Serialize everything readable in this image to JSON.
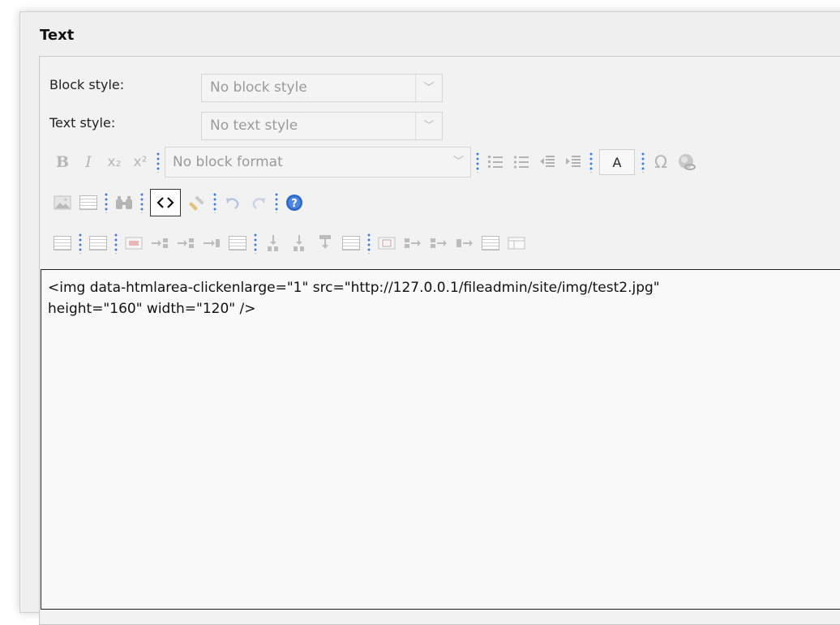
{
  "panel": {
    "title": "Text"
  },
  "block_style": {
    "label": "Block style:",
    "value": "No block style"
  },
  "text_style": {
    "label": "Text style:",
    "value": "No text style"
  },
  "toolbar": {
    "bold": "B",
    "italic": "I",
    "subscript": "x₂",
    "superscript": "x²",
    "block_format": "No block format",
    "text_color": "A",
    "special_char": "Ω"
  },
  "textarea": {
    "content": "<img data-htmlarea-clickenlarge=\"1\" src=\"http://127.0.0.1/fileadmin/site/img/test2.jpg\"\nheight=\"160\" width=\"120\" />"
  },
  "colors": {
    "separator": "#3f7cd6",
    "help": "#2a67c9"
  }
}
